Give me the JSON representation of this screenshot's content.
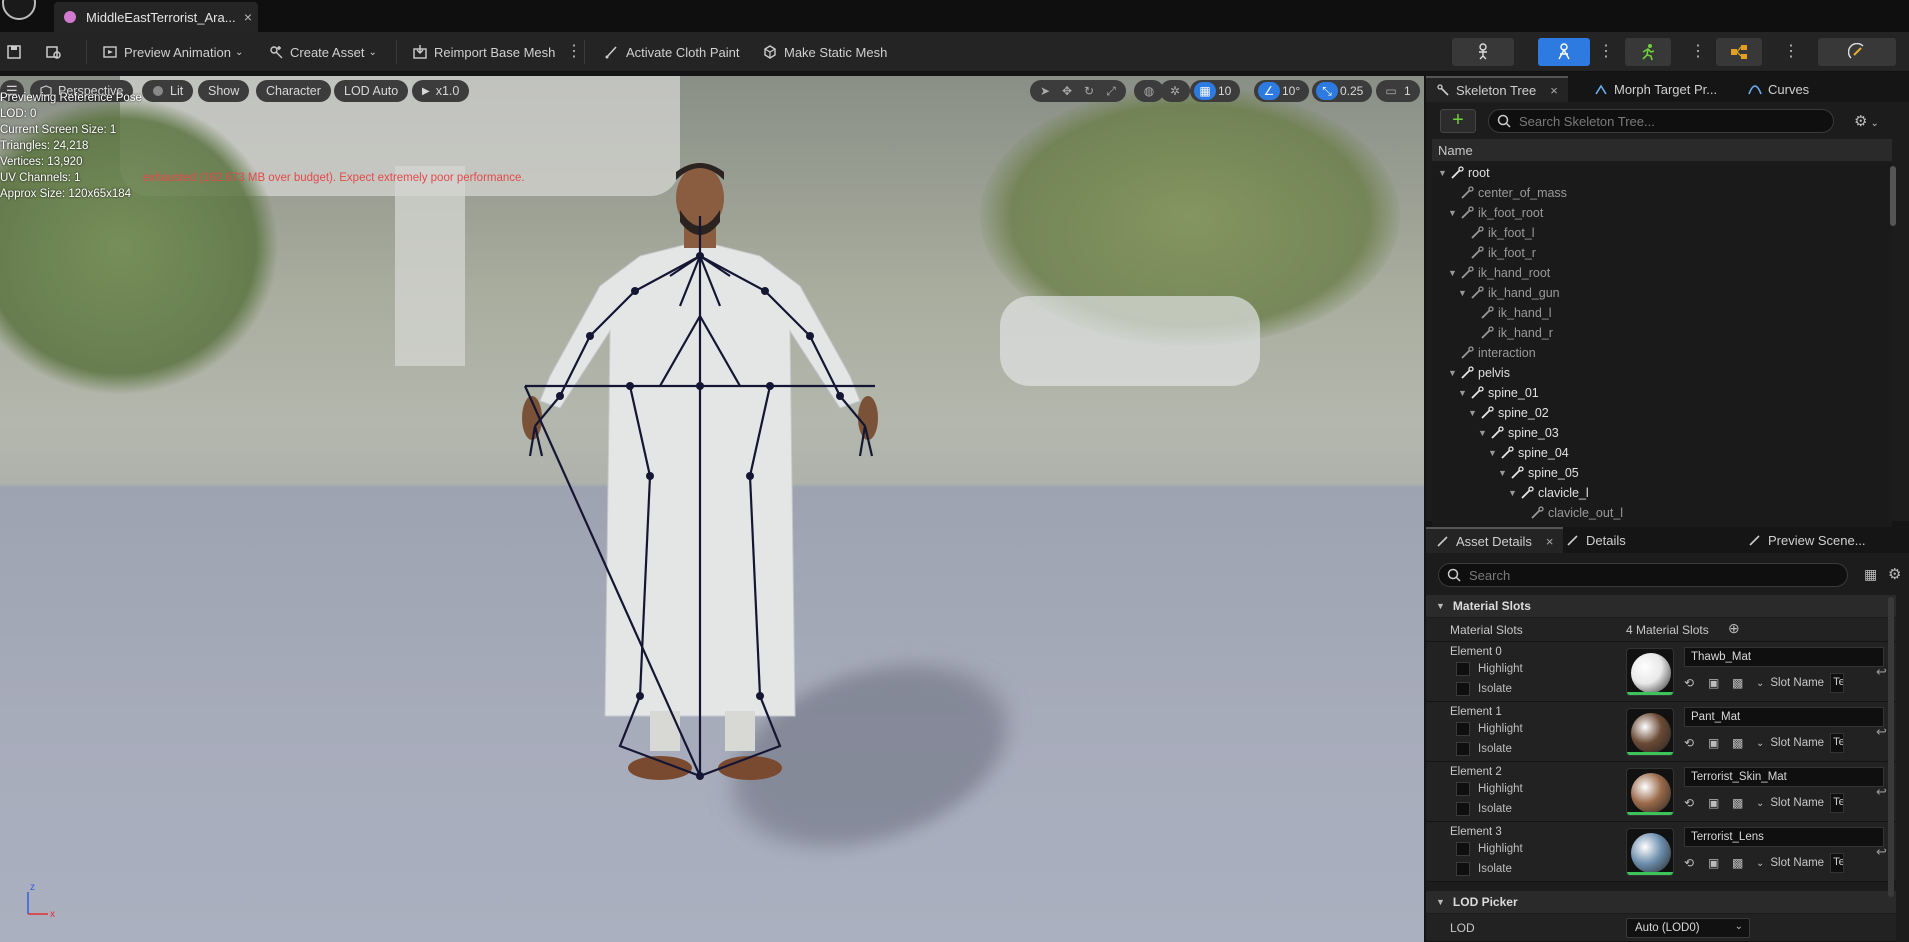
{
  "window": {
    "tab_title": "MiddleEastTerrorist_Ara...",
    "tab_close": "×"
  },
  "toolbar": {
    "preview_animation": "Preview Animation",
    "create_asset": "Create Asset",
    "reimport_base_mesh": "Reimport Base Mesh",
    "activate_cloth_paint": "Activate Cloth Paint",
    "make_static_mesh": "Make Static Mesh",
    "kebab": "⋮"
  },
  "viewport": {
    "perspective": "Perspective",
    "lit": "Lit",
    "show": "Show",
    "character": "Character",
    "lod": "LOD Auto",
    "play_rate": "x1.0",
    "grid_snap": "10",
    "rotate_snap": "10°",
    "scale_snap": "0.25",
    "camera_speed": "1",
    "stats": {
      "line1": "Previewing Reference Pose",
      "line2": "LOD: 0",
      "line3": "Current Screen Size: 1",
      "line4": "Triangles: 24,218",
      "line5": "Vertices: 13,920",
      "line6": "UV Channels: 1",
      "line7": "Approx Size: 120x65x184",
      "warning": "exhausted (162.673 MB over budget). Expect extremely poor performance."
    },
    "axis_x": "x",
    "axis_z": "z"
  },
  "skeleton_panel": {
    "tab_skeleton_tree": "Skeleton Tree",
    "tab_morph": "Morph Target Pr...",
    "tab_curves": "Curves",
    "close": "×",
    "search_placeholder": "Search Skeleton Tree...",
    "column_name": "Name",
    "bones": [
      {
        "name": "root",
        "depth": 0,
        "expanded": true,
        "bright": true
      },
      {
        "name": "center_of_mass",
        "depth": 1,
        "expanded": false,
        "bright": false
      },
      {
        "name": "ik_foot_root",
        "depth": 1,
        "expanded": true,
        "bright": false
      },
      {
        "name": "ik_foot_l",
        "depth": 2,
        "expanded": false,
        "bright": false
      },
      {
        "name": "ik_foot_r",
        "depth": 2,
        "expanded": false,
        "bright": false
      },
      {
        "name": "ik_hand_root",
        "depth": 1,
        "expanded": true,
        "bright": false
      },
      {
        "name": "ik_hand_gun",
        "depth": 2,
        "expanded": true,
        "bright": false
      },
      {
        "name": "ik_hand_l",
        "depth": 3,
        "expanded": false,
        "bright": false
      },
      {
        "name": "ik_hand_r",
        "depth": 3,
        "expanded": false,
        "bright": false
      },
      {
        "name": "interaction",
        "depth": 1,
        "expanded": false,
        "bright": false
      },
      {
        "name": "pelvis",
        "depth": 1,
        "expanded": true,
        "bright": true
      },
      {
        "name": "spine_01",
        "depth": 2,
        "expanded": true,
        "bright": true
      },
      {
        "name": "spine_02",
        "depth": 3,
        "expanded": true,
        "bright": true
      },
      {
        "name": "spine_03",
        "depth": 4,
        "expanded": true,
        "bright": true
      },
      {
        "name": "spine_04",
        "depth": 5,
        "expanded": true,
        "bright": true
      },
      {
        "name": "spine_05",
        "depth": 6,
        "expanded": true,
        "bright": true
      },
      {
        "name": "clavicle_l",
        "depth": 7,
        "expanded": true,
        "bright": true
      },
      {
        "name": "clavicle_out_l",
        "depth": 8,
        "expanded": false,
        "bright": false
      }
    ]
  },
  "details_panel": {
    "tab_asset_details": "Asset Details",
    "tab_details": "Details",
    "tab_preview_scene": "Preview Scene...",
    "close": "×",
    "search_placeholder": "Search",
    "section_material_slots": "Material Slots",
    "material_slots_label": "Material Slots",
    "material_slots_count": "4 Material Slots",
    "highlight": "Highlight",
    "isolate": "Isolate",
    "slot_name_label": "Slot Name",
    "slot_name_value": "Te",
    "elements": [
      {
        "label": "Element 0",
        "material": "Thawb_Mat",
        "color": "#e8e8e8"
      },
      {
        "label": "Element 1",
        "material": "Pant_Mat",
        "color": "#6b4a35"
      },
      {
        "label": "Element 2",
        "material": "Terrorist_Skin_Mat",
        "color": "#9a6a4a"
      },
      {
        "label": "Element 3",
        "material": "Terrorist_Lens",
        "color": "#6e8fae"
      }
    ],
    "section_lod_picker": "LOD Picker",
    "lod_label": "LOD",
    "lod_value": "Auto (LOD0)"
  }
}
